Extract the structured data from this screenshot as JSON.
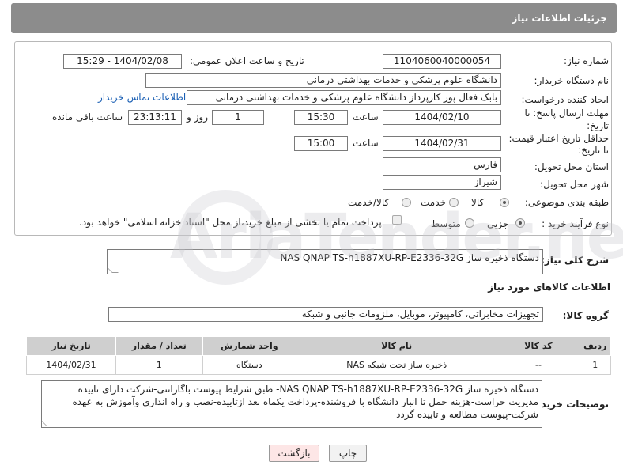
{
  "header": {
    "title": "جزئیات اطلاعات نیاز"
  },
  "form": {
    "need_number_label": "شماره نیاز:",
    "need_number": "1104060040000054",
    "announce_label": "تاریخ و ساعت اعلان عمومی:",
    "announce_value": "1404/02/08 - 15:29",
    "buyer_org_label": "نام دستگاه خریدار:",
    "buyer_org": "دانشگاه علوم پزشکی و خدمات بهداشتی درمانی",
    "creator_label": "ایجاد کننده درخواست:",
    "creator": "بابک فعال پور کارپرداز دانشگاه علوم پزشکی و خدمات بهداشتی درمانی",
    "contact_link": "اطلاعات تماس خریدار",
    "reply_deadline_label_1": "مهلت ارسال پاسخ: تا",
    "reply_deadline_label_2": "تاریخ:",
    "reply_date": "1404/02/10",
    "time_label": "ساعت",
    "reply_time": "15:30",
    "days_value": "1",
    "days_label": "روز و",
    "remaining_time": "23:13:11",
    "remaining_label": "ساعت باقی مانده",
    "price_valid_label_1": "حداقل تاریخ اعتبار قیمت:",
    "price_valid_label_2": "تا تاریخ:",
    "price_valid_date": "1404/02/31",
    "price_valid_time": "15:00",
    "province_label": "استان محل تحویل:",
    "province": "فارس",
    "city_label": "شهر محل تحویل:",
    "city": "شیراز",
    "category_label": "طبقه بندی موضوعی:",
    "category_options": [
      "کالا",
      "خدمت",
      "کالا/خدمت"
    ],
    "process_label": "نوع فرآیند خرید :",
    "process_options": [
      "جزیی",
      "متوسط"
    ],
    "payment_note": "پرداخت تمام یا بخشی از مبلغ خرید،از محل \"اسناد خزانه اسلامی\" خواهد بود."
  },
  "summary": {
    "label": "شرح کلی نیاز:",
    "text": "دستگاه ذخیره ساز NAS  QNAP TS-h1887XU-RP-E2336-32G"
  },
  "goods_section": {
    "title": "اطلاعات کالاهای مورد نیاز",
    "group_label": "گروه کالا:",
    "group_value": "تجهیزات مخابراتی، کامپیوتر، موبایل، ملزومات جانبی و شبکه"
  },
  "table": {
    "headers": [
      "ردیف",
      "کد کالا",
      "نام کالا",
      "واحد شمارش",
      "تعداد / مقدار",
      "تاریخ نیاز"
    ],
    "rows": [
      [
        "1",
        "--",
        "ذخیره ساز تحت شبکه NAS",
        "دستگاه",
        "1",
        "1404/02/31"
      ]
    ]
  },
  "notes": {
    "label": "توضیحات خریدار:",
    "text": "دستگاه ذخیره ساز NAS  QNAP TS-h1887XU-RP-E2336-32G- طبق شرایط پیوست باگارانتی-شرکت دارای تاییده مدیریت حراست-هزینه حمل تا انبار دانشگاه با فروشنده-پرداخت یکماه بعد ازتاییده-نصب و راه اندازی وآموزش به عهده شرکت-پیوست مطالعه و تاییده گردد"
  },
  "buttons": {
    "print": "چاپ",
    "back": "بازگشت"
  },
  "watermark": "AriaTender.neT"
}
